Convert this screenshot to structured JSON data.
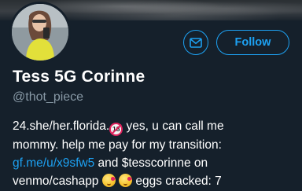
{
  "profile": {
    "display_name": "Tess 5G Corinne",
    "handle": "@thot_piece"
  },
  "buttons": {
    "message_icon": "envelope-icon",
    "follow_label": "Follow"
  },
  "bio": {
    "line1_text": "24.she/her.florida.",
    "line1_emoji": "18",
    "line1_tail": " yes, u can call me",
    "line2": "mommy. help me pay for my transition:",
    "line3_link": "gf.me/u/x9sfw5",
    "line3_tail": " and $tesscorinne on",
    "line4_head": "venmo/cashapp ",
    "line4_tail": " eggs cracked: 7"
  },
  "colors": {
    "background": "#15202b",
    "accent": "#1da1f2",
    "muted": "#8899a6",
    "text": "#ffffff"
  }
}
